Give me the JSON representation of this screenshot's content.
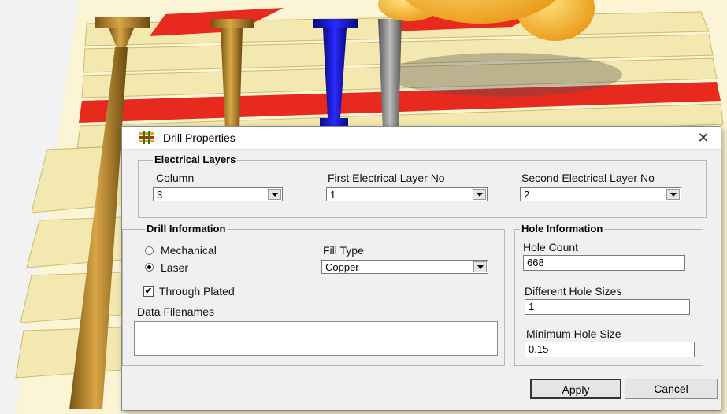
{
  "dialog": {
    "title": "Drill Properties",
    "close_symbol": "✕",
    "title_icon": "drill-properties-icon"
  },
  "electrical_layers": {
    "group_title": "Electrical Layers",
    "column": {
      "label": "Column",
      "value": "3"
    },
    "first_layer": {
      "label": "First Electrical Layer No",
      "value": "1"
    },
    "second_layer": {
      "label": "Second Electrical Layer No",
      "value": "2"
    }
  },
  "drill_information": {
    "group_title": "Drill Information",
    "mechanical_label": "Mechanical",
    "laser_label": "Laser",
    "selected": "Laser",
    "fill_type": {
      "label": "Fill Type",
      "value": "Copper"
    },
    "through_plated": {
      "label": "Through Plated",
      "checked": true,
      "check_symbol": "✔"
    },
    "data_filenames": {
      "label": "Data Filenames",
      "value": ""
    }
  },
  "hole_information": {
    "group_title": "Hole Information",
    "hole_count": {
      "label": "Hole Count",
      "value": "668"
    },
    "different_hole_sizes": {
      "label": "Different Hole Sizes",
      "value": "1"
    },
    "minimum_hole_size": {
      "label": "Minimum Hole Size",
      "value": "0.15"
    }
  },
  "buttons": {
    "apply": "Apply",
    "cancel": "Cancel"
  },
  "colors": {
    "pcb_layer": "#f3e9b0",
    "pcb_layer_edge": "#c9bb6e",
    "red_layer": "#e82a1e",
    "via_gold": "#b8872a",
    "via_blue": "#1a1acc",
    "via_gray": "#8a8a8a",
    "emoji": "#f5b728"
  }
}
